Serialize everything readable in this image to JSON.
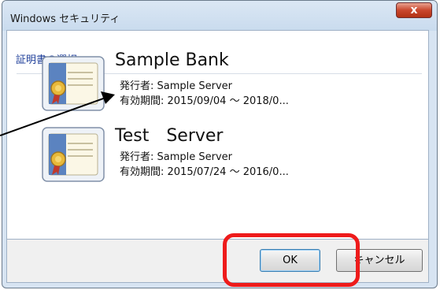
{
  "window": {
    "title": "Windows セキュリティ",
    "close_label": "x"
  },
  "dialog": {
    "heading": "証明書の選択",
    "certificates": [
      {
        "name": "Sample Bank",
        "issuer": "発行者: Sample Server",
        "validity": "有効期間: 2015/09/04 ～ 2018/0...",
        "icon": "certificate-icon"
      },
      {
        "name": "Test　Server",
        "issuer": "発行者: Sample Server",
        "validity": "有効期間: 2015/07/24 ～ 2016/0...",
        "icon": "certificate-icon"
      }
    ]
  },
  "footer": {
    "ok_label": "OK",
    "cancel_label": "キャンセル"
  },
  "colors": {
    "accent": "#1f3f9a",
    "highlight": "#ee1b1b",
    "close": "#c9472d"
  }
}
